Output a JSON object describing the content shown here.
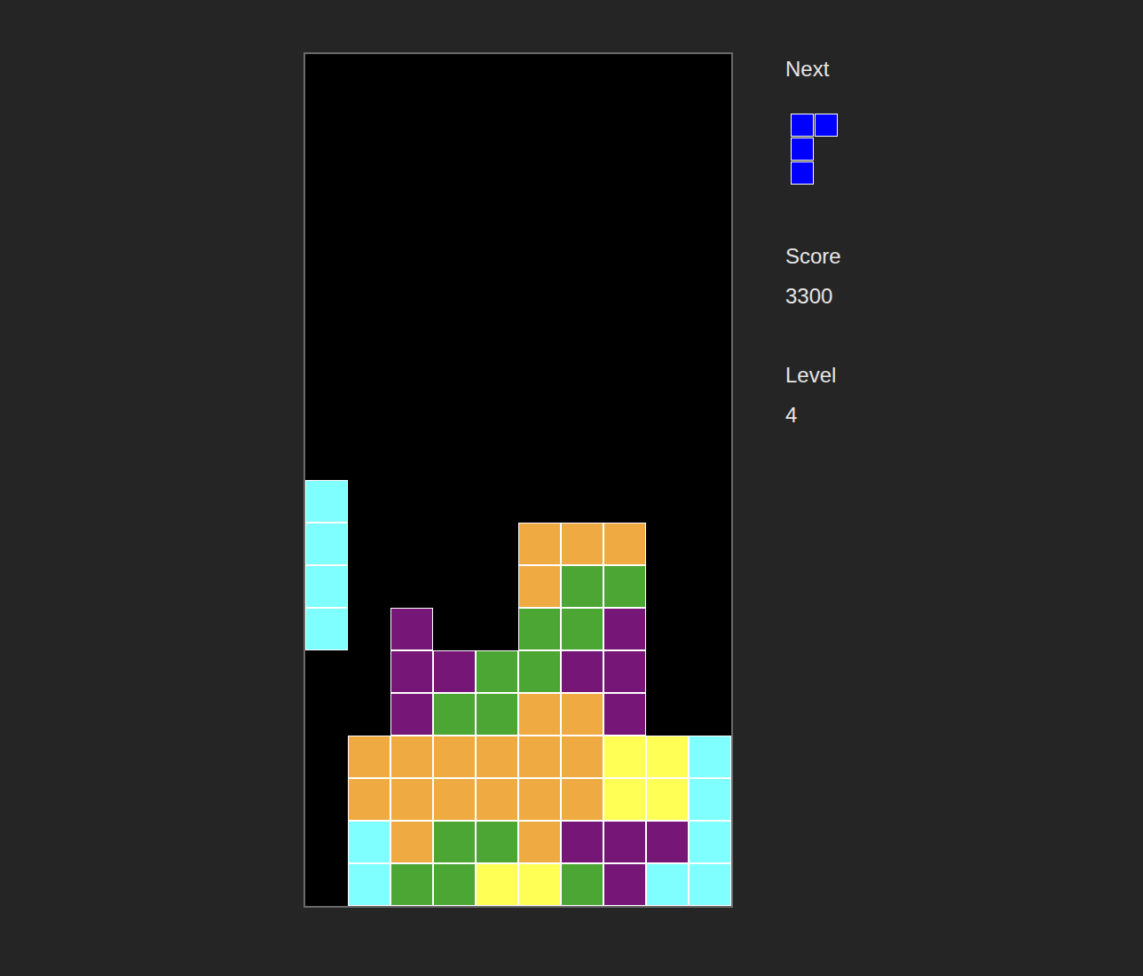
{
  "board": {
    "rows": [
      [
        null,
        null,
        null,
        null,
        null,
        null,
        null,
        null,
        null,
        null
      ],
      [
        null,
        null,
        null,
        null,
        null,
        null,
        null,
        null,
        null,
        null
      ],
      [
        null,
        null,
        null,
        null,
        null,
        null,
        null,
        null,
        null,
        null
      ],
      [
        null,
        null,
        null,
        null,
        null,
        null,
        null,
        null,
        null,
        null
      ],
      [
        null,
        null,
        null,
        null,
        null,
        null,
        null,
        null,
        null,
        null
      ],
      [
        null,
        null,
        null,
        null,
        null,
        null,
        null,
        null,
        null,
        null
      ],
      [
        null,
        null,
        null,
        null,
        null,
        null,
        null,
        null,
        null,
        null
      ],
      [
        null,
        null,
        null,
        null,
        null,
        null,
        null,
        null,
        null,
        null
      ],
      [
        null,
        null,
        null,
        null,
        null,
        null,
        null,
        null,
        null,
        null
      ],
      [
        null,
        null,
        null,
        null,
        null,
        null,
        null,
        null,
        null,
        null
      ],
      [
        "#7fffff",
        null,
        null,
        null,
        null,
        null,
        null,
        null,
        null,
        null
      ],
      [
        "#7fffff",
        null,
        null,
        null,
        null,
        "#f0aa42",
        "#f0aa42",
        "#f0aa42",
        null,
        null
      ],
      [
        "#7fffff",
        null,
        null,
        null,
        null,
        "#f0aa42",
        "#4ba633",
        "#4ba633",
        null,
        null
      ],
      [
        "#7fffff",
        null,
        "#761677",
        null,
        null,
        "#4ba633",
        "#4ba633",
        "#761677",
        null,
        null
      ],
      [
        null,
        null,
        "#761677",
        "#761677",
        "#4ba633",
        "#4ba633",
        "#761677",
        "#761677",
        null,
        null
      ],
      [
        null,
        null,
        "#761677",
        "#4ba633",
        "#4ba633",
        "#f0aa42",
        "#f0aa42",
        "#761677",
        null,
        null
      ],
      [
        null,
        "#f0aa42",
        "#f0aa42",
        "#f0aa42",
        "#f0aa42",
        "#f0aa42",
        "#f0aa42",
        "#ffff55",
        "#ffff55",
        "#7fffff"
      ],
      [
        null,
        "#f0aa42",
        "#f0aa42",
        "#f0aa42",
        "#f0aa42",
        "#f0aa42",
        "#f0aa42",
        "#ffff55",
        "#ffff55",
        "#7fffff"
      ],
      [
        null,
        "#7fffff",
        "#f0aa42",
        "#4ba633",
        "#4ba633",
        "#f0aa42",
        "#761677",
        "#761677",
        "#761677",
        "#7fffff"
      ],
      [
        null,
        "#7fffff",
        "#4ba633",
        "#4ba633",
        "#ffff55",
        "#ffff55",
        "#4ba633",
        "#761677",
        "#7fffff",
        "#7fffff"
      ]
    ]
  },
  "next": {
    "label": "Next",
    "color": "#0000ff",
    "shape": [
      [
        true,
        true
      ],
      [
        true,
        false
      ],
      [
        true,
        false
      ]
    ]
  },
  "score": {
    "label": "Score",
    "value": "3300"
  },
  "level": {
    "label": "Level",
    "value": "4"
  }
}
